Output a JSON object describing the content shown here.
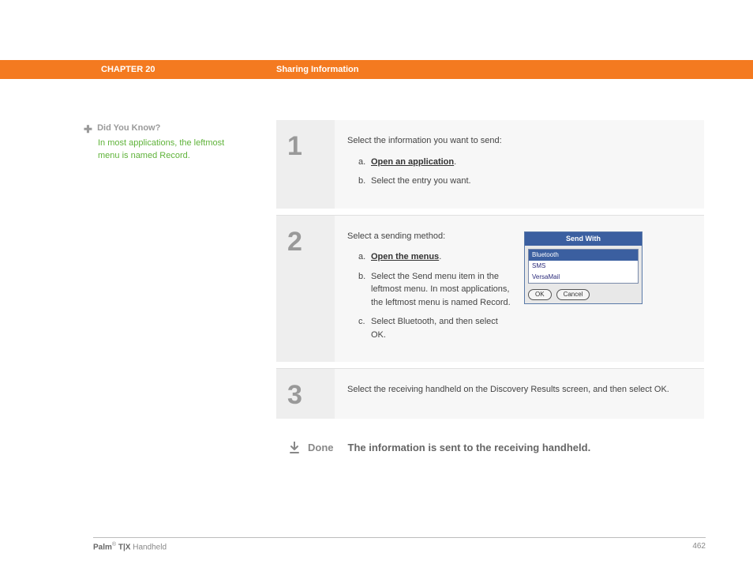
{
  "header": {
    "chapter": "CHAPTER 20",
    "title": "Sharing Information"
  },
  "sidebar": {
    "plus": "✚",
    "dyk_title": "Did You Know?",
    "dyk_body": "In most applications, the leftmost menu is named Record."
  },
  "steps": [
    {
      "num": "1",
      "intro": "Select the information you want to send:",
      "items": [
        {
          "label": "a.",
          "text_prefix": "",
          "link": "Open an application",
          "text_suffix": "."
        },
        {
          "label": "b.",
          "text_prefix": "Select the entry you want.",
          "link": "",
          "text_suffix": ""
        }
      ]
    },
    {
      "num": "2",
      "intro": "Select a sending method:",
      "items": [
        {
          "label": "a.",
          "text_prefix": "",
          "link": "Open the menus",
          "text_suffix": "."
        },
        {
          "label": "b.",
          "text_prefix": "Select the Send menu item in the leftmost menu. In most applications, the leftmost menu is named Record.",
          "link": "",
          "text_suffix": ""
        },
        {
          "label": "c.",
          "text_prefix": "Select Bluetooth, and then select OK.",
          "link": "",
          "text_suffix": ""
        }
      ],
      "dialog": {
        "title": "Send With",
        "options": [
          "Bluetooth",
          "SMS",
          "VersaMail"
        ],
        "selected": 0,
        "ok": "OK",
        "cancel": "Cancel"
      }
    },
    {
      "num": "3",
      "intro": "Select the receiving handheld on the Discovery Results screen, and then select OK.",
      "items": []
    }
  ],
  "done": {
    "label": "Done",
    "text": "The information is sent to the receiving handheld."
  },
  "footer": {
    "brand_bold": "Palm",
    "brand_sup": "®",
    "brand_model": " T|X",
    "brand_rest": " Handheld",
    "page": "462"
  }
}
